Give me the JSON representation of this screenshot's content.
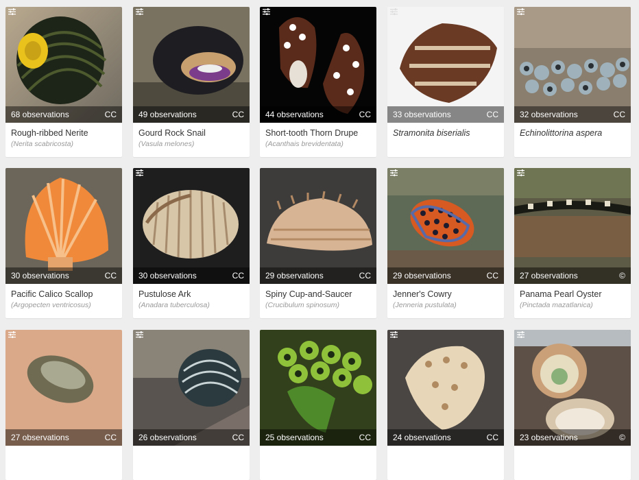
{
  "cards": [
    {
      "count": "68 observations",
      "license": "CC",
      "common": "Rough-ribbed Nerite",
      "scientific": "(Nerita scabricosta)",
      "italic": false
    },
    {
      "count": "49 observations",
      "license": "CC",
      "common": "Gourd Rock Snail",
      "scientific": "(Vasula melones)",
      "italic": false
    },
    {
      "count": "44 observations",
      "license": "CC",
      "common": "Short-tooth Thorn Drupe",
      "scientific": "(Acanthais brevidentata)",
      "italic": false
    },
    {
      "count": "33 observations",
      "license": "CC",
      "common": "Stramonita biserialis",
      "scientific": "",
      "italic": true
    },
    {
      "count": "32 observations",
      "license": "CC",
      "common": "Echinolittorina aspera",
      "scientific": "",
      "italic": true
    },
    {
      "count": "30 observations",
      "license": "CC",
      "common": "Pacific Calico Scallop",
      "scientific": "(Argopecten ventricosus)",
      "italic": false
    },
    {
      "count": "30 observations",
      "license": "CC",
      "common": "Pustulose Ark",
      "scientific": "(Anadara tuberculosa)",
      "italic": false
    },
    {
      "count": "29 observations",
      "license": "CC",
      "common": "Spiny Cup-and-Saucer",
      "scientific": "(Crucibulum spinosum)",
      "italic": false
    },
    {
      "count": "29 observations",
      "license": "CC",
      "common": "Jenner's Cowry",
      "scientific": "(Jenneria pustulata)",
      "italic": false
    },
    {
      "count": "27 observations",
      "license": "©",
      "common": "Panama Pearl Oyster",
      "scientific": "(Pinctada mazatlanica)",
      "italic": false
    },
    {
      "count": "27 observations",
      "license": "CC",
      "common": "",
      "scientific": "",
      "italic": false
    },
    {
      "count": "26 observations",
      "license": "CC",
      "common": "",
      "scientific": "",
      "italic": false
    },
    {
      "count": "25 observations",
      "license": "CC",
      "common": "",
      "scientific": "",
      "italic": false
    },
    {
      "count": "24 observations",
      "license": "CC",
      "common": "",
      "scientific": "",
      "italic": false
    },
    {
      "count": "23 observations",
      "license": "©",
      "common": "",
      "scientific": "",
      "italic": false
    }
  ]
}
